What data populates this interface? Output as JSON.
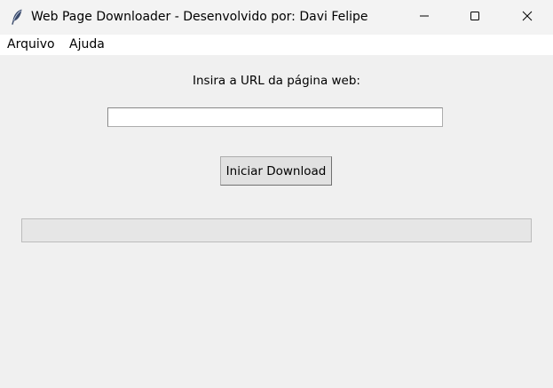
{
  "window": {
    "title": "Web Page Downloader - Desenvolvido por: Davi Felipe",
    "app_icon": "feather-icon",
    "controls": [
      "minimize-icon",
      "maximize-icon",
      "close-icon"
    ]
  },
  "menu": {
    "items": [
      {
        "label": "Arquivo"
      },
      {
        "label": "Ajuda"
      }
    ]
  },
  "form": {
    "url_label": "Insira a URL da página web:",
    "url_value": "",
    "url_placeholder": "",
    "download_button": "Iniciar Download"
  },
  "progress": {
    "value": 0
  }
}
